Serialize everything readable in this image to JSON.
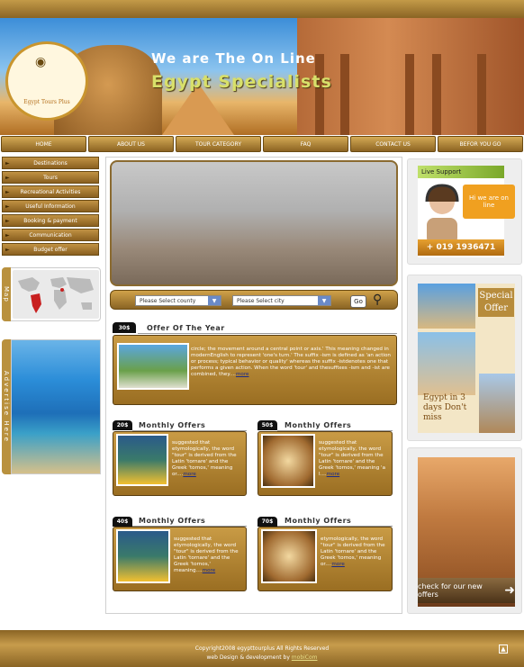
{
  "banner": {
    "headline_line1": "We are The On Line",
    "headline_line2": "Egypt Specialists",
    "logo_text": "Egypt Tours Plus"
  },
  "nav": [
    "HOME",
    "ABOUT US",
    "TOUR CATEGORY",
    "FAQ",
    "CONTACT US",
    "BEFOR YOU GO"
  ],
  "sidebar": {
    "items": [
      "Destinations",
      "Tours",
      "Recreational Activities",
      "Useful Information",
      "Booking & payment",
      "Communication",
      "Budget offer"
    ],
    "map_label": "Map",
    "advertise_label": "Advertise Here"
  },
  "search": {
    "country_placeholder": "Please Select county",
    "city_placeholder": "Please Select city",
    "go_label": "Go"
  },
  "offer_year": {
    "title": "Offer Of The Year",
    "price": "30$",
    "text": "circle; the movement around a central point or axis.' This meaning changed in modernEnglish to represent 'one's turn.' The suffix -ism is defined as 'an action or process; typical behavior or quality' whereas the suffix -istdenotes one that performs a given action. When the word 'tour' and thesuffixes -ism and -ist are combined, they....",
    "more": "more"
  },
  "monthly": [
    {
      "title": "Monthly Offers",
      "price": "20$",
      "text": "suggested that etymologically, the word \"tour\" is derived from the Latin 'tornare' and the Greek 'tornos,' meaning or....",
      "more": "more"
    },
    {
      "title": "Monthly Offers",
      "price": "50$",
      "text": "suggested that etymologically, the word \"tour\" is derived from the Latin 'tornare' and the Greek 'tornos,' meaning 'a l....",
      "more": "more"
    },
    {
      "title": "Monthly Offers",
      "price": "40$",
      "text": "suggested that etymologically, the word \"tour\" is derived from the Latin 'tornare' and the Greek 'tornos,' meaning....",
      "more": "more"
    },
    {
      "title": "Monthly Offers",
      "price": "70$",
      "text": "etymologically, the word \"tour\" is derived from the Latin 'tornare' and the Greek 'tornos,' meaning or....",
      "more": "more"
    }
  ],
  "live_support": {
    "title": "Live Support",
    "bubble": "Hi we are on line",
    "phone": "+ 019 1936471"
  },
  "special_offer": {
    "label": "Special Offer",
    "caption": "Egypt in 3 days Don't miss"
  },
  "new_offers": {
    "button": "check for our new offers"
  },
  "footer": {
    "copyright": "Copyright2008 egypttourplus All Rights Reserved",
    "dev_prefix": "web Design & development by",
    "dev_link": "mobiCom"
  },
  "colors": {
    "gold": "#b9913e",
    "dark_gold": "#8a6424",
    "accent_blue": "#1a2a8a"
  }
}
